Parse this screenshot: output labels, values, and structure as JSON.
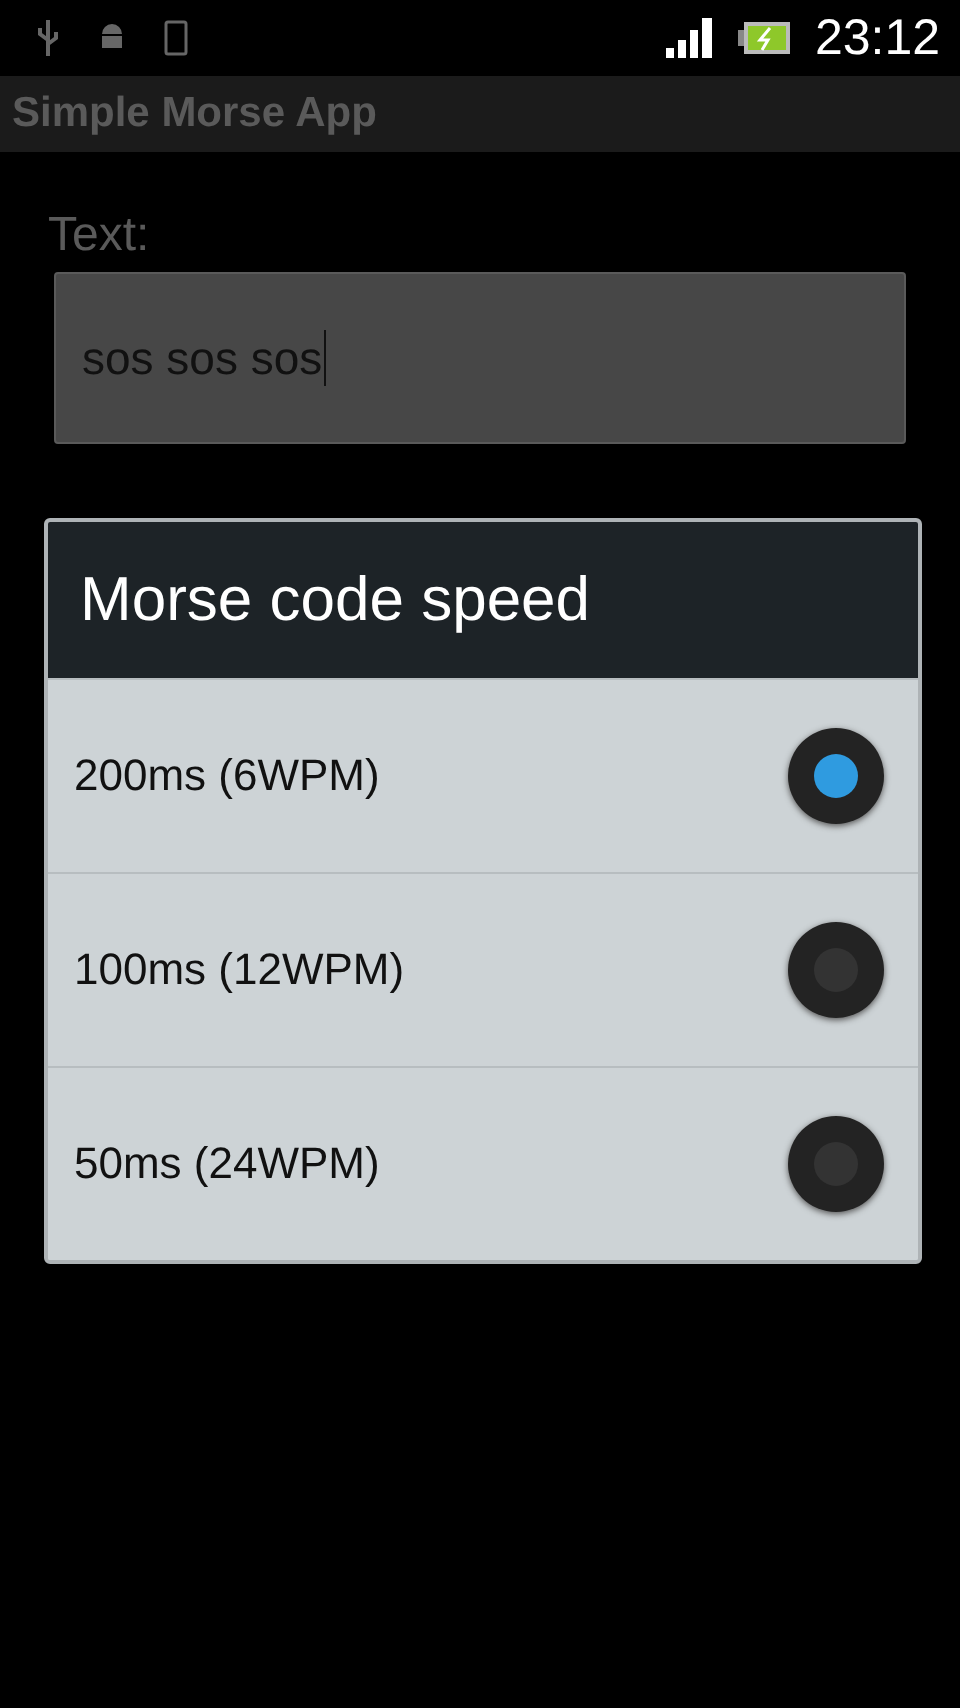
{
  "status_bar": {
    "time": "23:12"
  },
  "app_bar": {
    "title": "Simple Morse App"
  },
  "form": {
    "label": "Text:",
    "value": "sos sos sos"
  },
  "dialog": {
    "title": "Morse code speed",
    "options": [
      {
        "label": "200ms (6WPM)",
        "selected": true
      },
      {
        "label": "100ms (12WPM)",
        "selected": false
      },
      {
        "label": "50ms (24WPM)",
        "selected": false
      }
    ]
  }
}
